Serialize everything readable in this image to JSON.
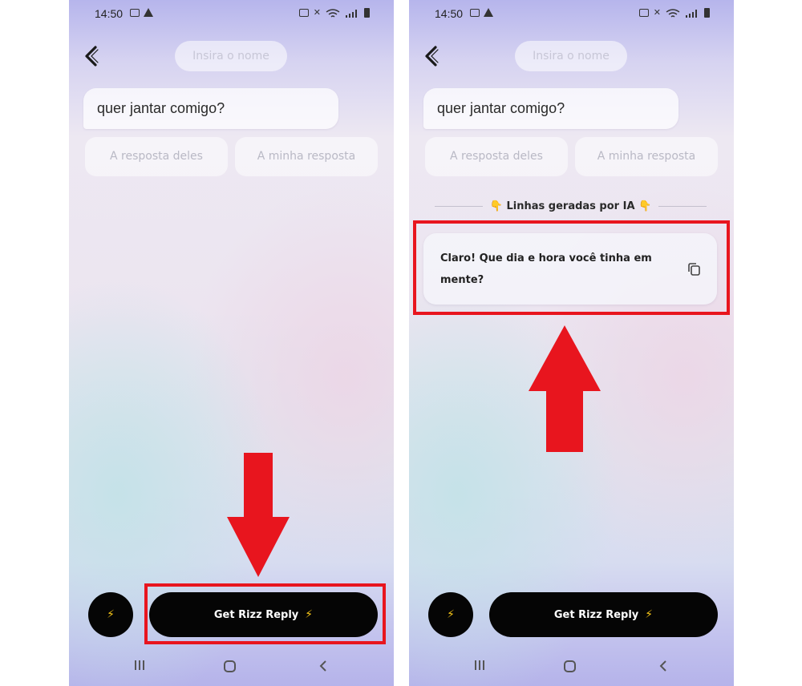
{
  "status_bar": {
    "time": "14:50"
  },
  "header": {
    "name_placeholder": "Insira o nome"
  },
  "message": {
    "text": "quer jantar comigo?"
  },
  "response_buttons": {
    "theirs": "A resposta deles",
    "mine": "A minha resposta"
  },
  "ai_section": {
    "label": "Linhas geradas por IA",
    "hand_emoji": "👇",
    "reply": "Claro! Que dia e hora você tinha em mente?"
  },
  "action_bar": {
    "get_reply_label": "Get Rizz Reply",
    "bolt_icon": "lightning-bolt-icon"
  },
  "annotation_color": "#e8151e",
  "accent_colors": {
    "button_bg": "#050505",
    "bolt": "#f5c518"
  }
}
